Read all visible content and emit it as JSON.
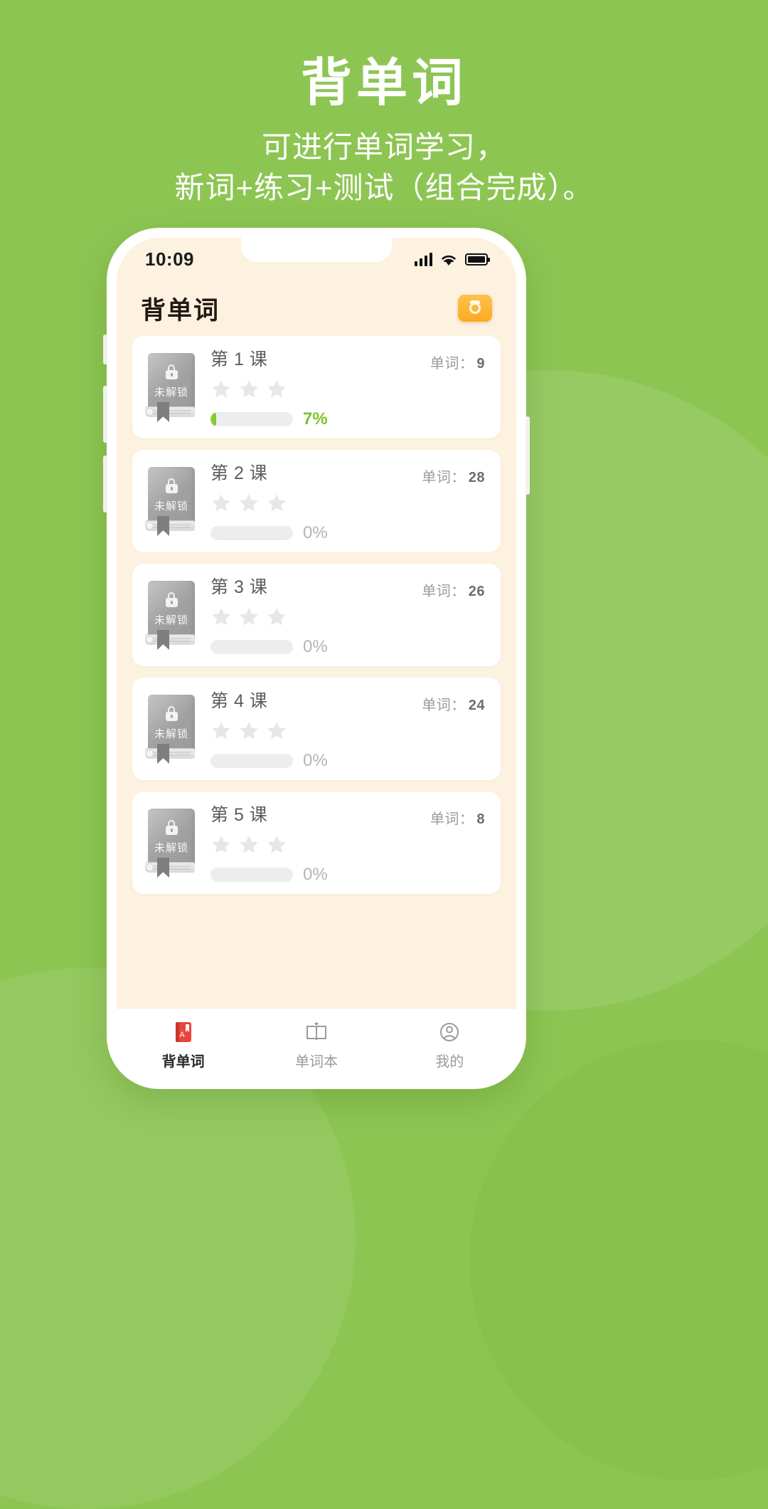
{
  "promo": {
    "title": "背单词",
    "subtitle_line1": "可进行单词学习，",
    "subtitle_line2": "新词+练习+测试（组合完成）。",
    "bg_color": "#8dc553",
    "text_color": "#ffffff"
  },
  "status_bar": {
    "time": "10:09",
    "signal_icon": "signal-bars-icon",
    "wifi_icon": "wifi-icon",
    "battery_icon": "battery-full-icon"
  },
  "appbar": {
    "title": "背单词",
    "camera_icon": "camera-icon",
    "camera_color": "#fbab22"
  },
  "list": {
    "count_label": "单词：",
    "locked_text": "未解锁",
    "star_count": 3,
    "lessons": [
      {
        "title": "第 1 课",
        "count": "9",
        "percent": "7%",
        "progress": 7,
        "active": true
      },
      {
        "title": "第 2 课",
        "count": "28",
        "percent": "0%",
        "progress": 0,
        "active": false
      },
      {
        "title": "第 3 课",
        "count": "26",
        "percent": "0%",
        "progress": 0,
        "active": false
      },
      {
        "title": "第 4 课",
        "count": "24",
        "percent": "0%",
        "progress": 0,
        "active": false
      },
      {
        "title": "第 5 课",
        "count": "8",
        "percent": "0%",
        "progress": 0,
        "active": false
      }
    ]
  },
  "tabbar": {
    "items": [
      {
        "label": "背单词",
        "icon": "red-book-icon",
        "active": true
      },
      {
        "label": "单词本",
        "icon": "open-book-icon",
        "active": false
      },
      {
        "label": "我的",
        "icon": "profile-icon",
        "active": false
      }
    ]
  }
}
